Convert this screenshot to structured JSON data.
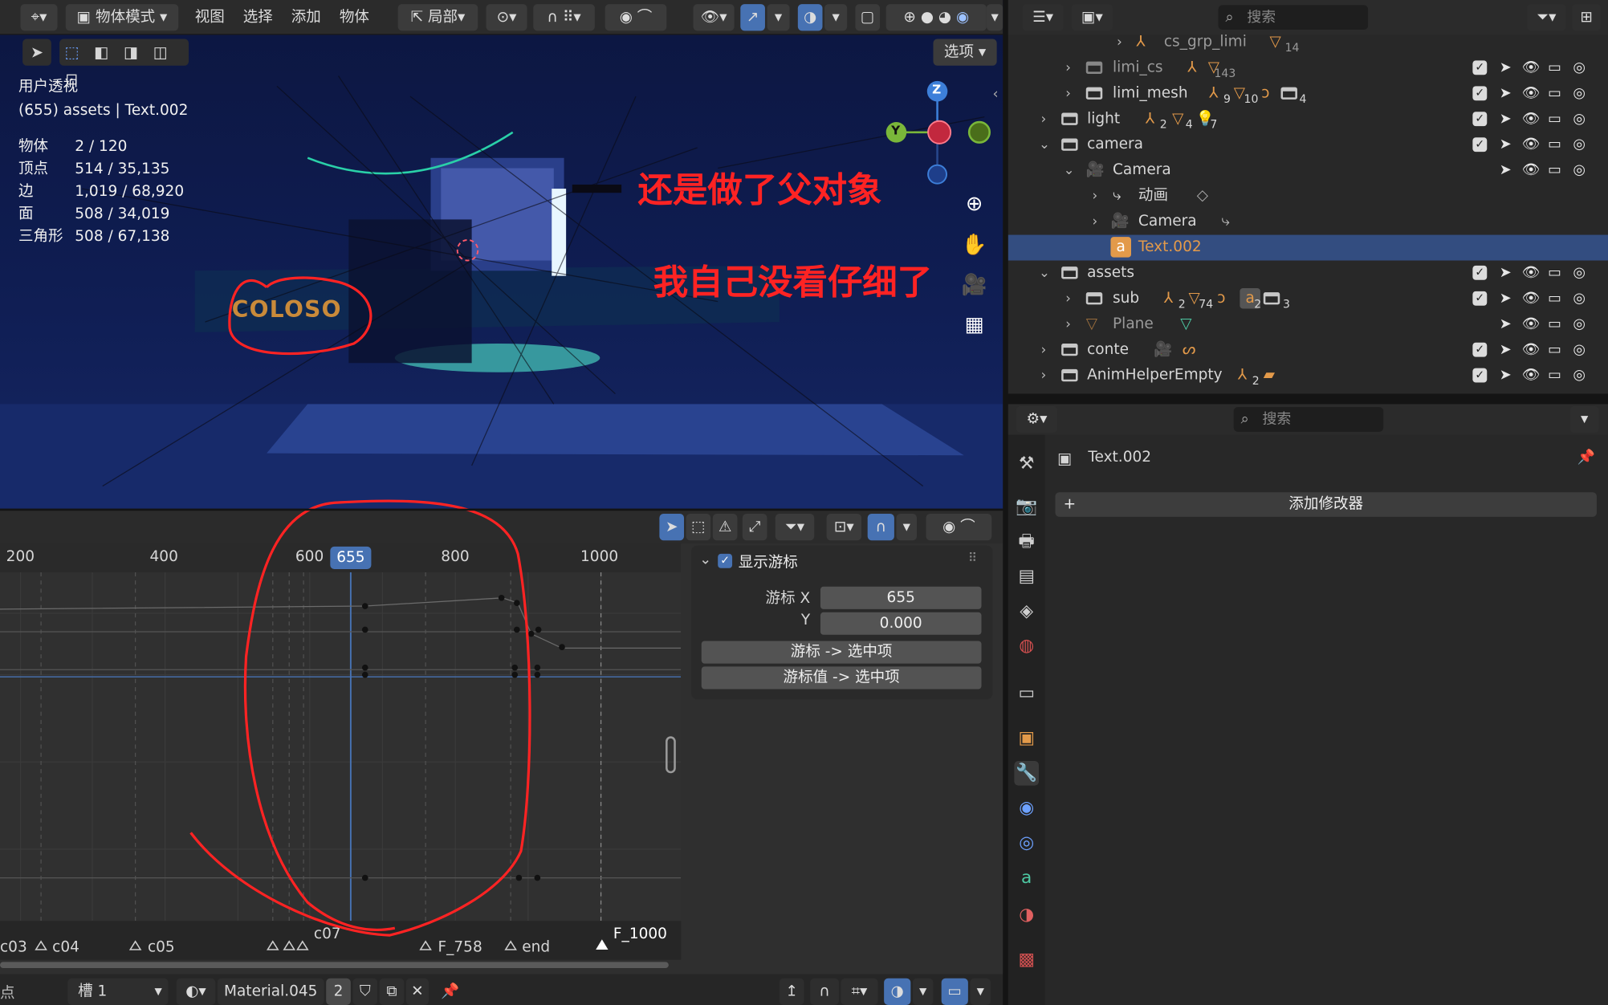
{
  "viewport": {
    "mode_label": "物体模式",
    "menus": [
      "视图",
      "选择",
      "添加",
      "物体"
    ],
    "pivot_label": "局部",
    "options_label": "选项",
    "view_name": "用户透视",
    "frame_info": "(655) assets | Text.002",
    "stats": [
      {
        "key": "物体",
        "value": "2 / 120"
      },
      {
        "key": "顶点",
        "value": "514 / 35,135"
      },
      {
        "key": "边",
        "value": "1,019 / 68,920"
      },
      {
        "key": "面",
        "value": "508 / 34,019"
      },
      {
        "key": "三角形",
        "value": "508 / 67,138"
      }
    ],
    "gizmo": {
      "z": "Z",
      "y": "Y"
    },
    "scene_text": "COLOSO"
  },
  "annotations": {
    "line1": "还是做了父对象",
    "line2": "我自己没看仔细了",
    "color": "#ff2323"
  },
  "graph": {
    "ruler_ticks": [
      "200",
      "400",
      "600",
      "800",
      "1000"
    ],
    "current_frame": "655",
    "markers": [
      "c03",
      "c04",
      "c05",
      "c07",
      "F_758",
      "end",
      "F_1000"
    ],
    "npanel": {
      "title": "显示游标",
      "cursor_x_label": "游标 X",
      "cursor_x_value": "655",
      "cursor_y_label": "Y",
      "cursor_y_value": "0.000",
      "btn_cursor_to_selected": "游标 -> 选中项",
      "btn_value_to_selected": "游标值 -> 选中项"
    }
  },
  "statusbar": {
    "slot_label": "槽 1",
    "material_name": "Material.045",
    "users": "2",
    "left_fragment": "点"
  },
  "outliner": {
    "search_placeholder": "搜索",
    "rows": [
      {
        "label": "cs_grp_limi",
        "badge": "14",
        "dim": true
      },
      {
        "label": "limi_cs",
        "badge": "143",
        "dim": true
      },
      {
        "label": "limi_mesh",
        "badges": [
          "9",
          "10",
          "4"
        ]
      },
      {
        "label": "light",
        "badges": [
          "2",
          "4",
          "7"
        ]
      },
      {
        "label": "camera"
      },
      {
        "label": "Camera"
      },
      {
        "label": "动画"
      },
      {
        "label": "Camera"
      },
      {
        "label": "Text.002",
        "selected": true
      },
      {
        "label": "assets"
      },
      {
        "label": "sub",
        "badges": [
          "2",
          "74",
          "2",
          "3"
        ]
      },
      {
        "label": "Plane",
        "dim": true
      },
      {
        "label": "conte"
      },
      {
        "label": "AnimHelperEmpty",
        "badges": [
          "2"
        ]
      }
    ]
  },
  "properties": {
    "search_placeholder": "搜索",
    "object_name": "Text.002",
    "add_modifier_label": "添加修改器"
  },
  "colors": {
    "accent_blue": "#4772b3",
    "selection_row": "#334d80",
    "orange_icon": "#e39a4a",
    "annotation_red": "#ff2323"
  }
}
